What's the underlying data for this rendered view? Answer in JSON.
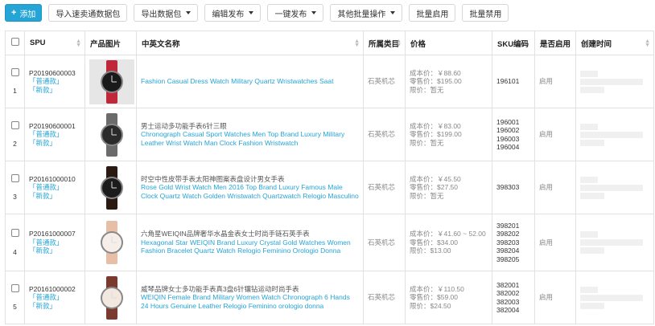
{
  "toolbar": {
    "add": "添加",
    "import": "导入速卖通数据包",
    "export": "导出数据包",
    "edit_publish": "编辑发布",
    "one_click_publish": "一键发布",
    "other_batch": "其他批量操作",
    "batch_enable": "批量启用",
    "batch_disable": "批量禁用"
  },
  "columns": {
    "spu": "SPU",
    "image": "产品图片",
    "name": "中英文名称",
    "category": "所属类目",
    "price": "价格",
    "sku": "SKU编码",
    "enabled": "是否启用",
    "created": "创建时间"
  },
  "labels": {
    "cost": "成本价：",
    "retail": "零售价：",
    "limit": "限价："
  },
  "rows": [
    {
      "index": "1",
      "spu": "P20190600003",
      "tag1": "「普通款」",
      "tag2": "「新款」",
      "name_cn": "",
      "name_en": "Fashion Casual Dress Watch Military Quartz Wristwatches Saat",
      "category": "石英机芯",
      "cost": "￥88.60",
      "retail": "$195.00",
      "limit": "暂无",
      "skus": [
        "196101"
      ],
      "status": "启用"
    },
    {
      "index": "2",
      "spu": "P20190600001",
      "tag1": "「普通款」",
      "tag2": "「新款」",
      "name_cn": "男士运动多功能手表6针三眼",
      "name_en": "Chronograph Casual Sport Watches Men Top Brand Luxury Military Leather Wrist Watch Man Clock Fashion Wristwatch",
      "category": "石英机芯",
      "cost": "￥83.00",
      "retail": "$199.00",
      "limit": "暂无",
      "skus": [
        "196001",
        "196002",
        "196003",
        "196004"
      ],
      "status": "启用"
    },
    {
      "index": "3",
      "spu": "P20161000010",
      "tag1": "「普通款」",
      "tag2": "「新款」",
      "name_cn": "时空中性皮带手表太阳神图案表盘设计男女手表",
      "name_en": "Rose Gold Wrist Watch Men 2016 Top Brand Luxury Famous Male Clock Quartz Watch Golden Wristwatch Quartzwatch Relogio Masculino",
      "category": "石英机芯",
      "cost": "￥45.50",
      "retail": "$27.50",
      "limit": "暂无",
      "skus": [
        "398303"
      ],
      "status": "启用"
    },
    {
      "index": "4",
      "spu": "P20161000007",
      "tag1": "「普通款」",
      "tag2": "「新款」",
      "name_cn": "六角星WEIQIN品牌奢华水晶金表女士时尚手链石英手表",
      "name_en": "Hexagonal Star WEIQIN Brand Luxury Crystal Gold Watches Women Fashion Bracelet Quartz Watch Relogio Feminino Orologio Donna",
      "category": "石英机芯",
      "cost": "￥41.60 ~ 52.00",
      "retail": "$34.00",
      "limit": "$13.00",
      "skus": [
        "398201",
        "398202",
        "398203",
        "398204",
        "398205"
      ],
      "status": "启用"
    },
    {
      "index": "5",
      "spu": "P20161000002",
      "tag1": "「普通款」",
      "tag2": "「新款」",
      "name_cn": "威琴品牌女士多功能手表真3盘6针镶钻运动时尚手表",
      "name_en": "WEIQIN Female Brand Military Women Watch Chronograph 6 Hands 24 Hours Genuine Leather Relogio Feminino orologio donna",
      "category": "石英机芯",
      "cost": "￥110.50",
      "retail": "$59.00",
      "limit": "$24.50",
      "skus": [
        "382001",
        "382002",
        "382003",
        "382004"
      ],
      "status": "启用"
    }
  ],
  "colors": {
    "accent": "#25a4d6",
    "border": "#e1e1e1"
  }
}
